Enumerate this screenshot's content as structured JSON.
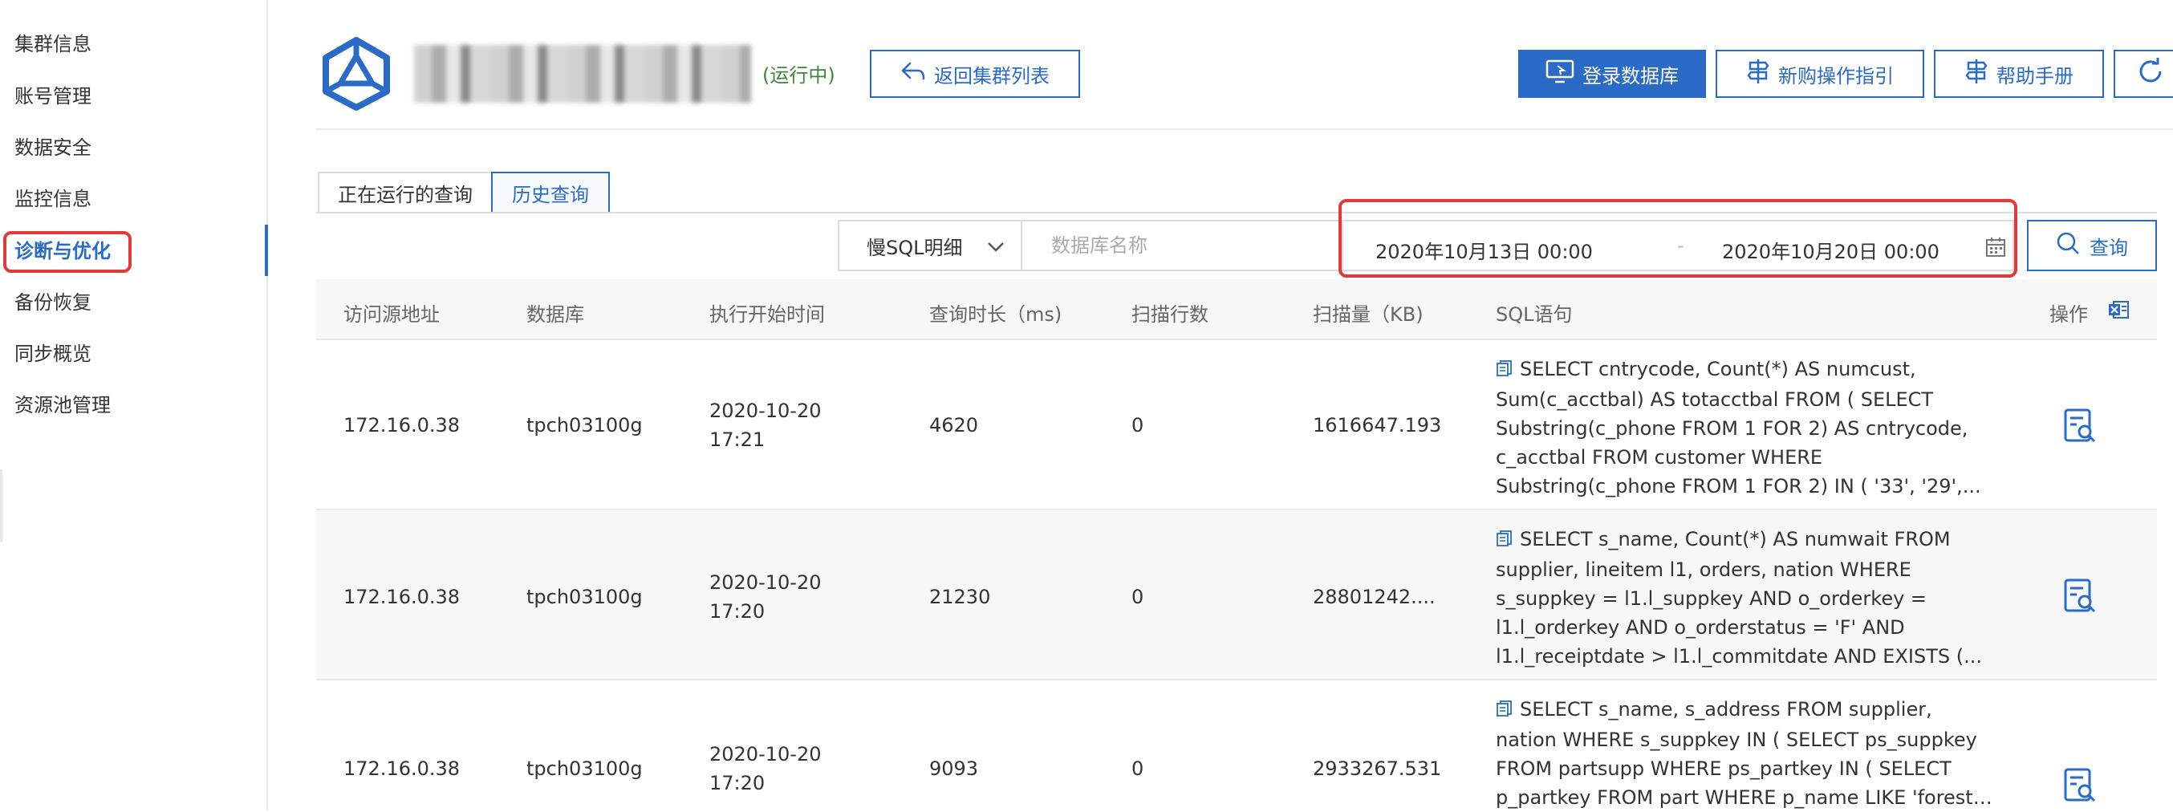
{
  "sidebar": {
    "items": [
      {
        "label": "集群信息"
      },
      {
        "label": "账号管理"
      },
      {
        "label": "数据安全"
      },
      {
        "label": "监控信息"
      },
      {
        "label": "诊断与优化",
        "active": true
      },
      {
        "label": "备份恢复"
      },
      {
        "label": "同步概览"
      },
      {
        "label": "资源池管理"
      }
    ]
  },
  "header": {
    "status": "(运行中)",
    "back_button": "返回集群列表",
    "login_db_button": "登录数据库",
    "purchase_guide_button": "新购操作指引",
    "help_button": "帮助手册"
  },
  "tabs": [
    {
      "label": "正在运行的查询"
    },
    {
      "label": "历史查询",
      "active": true
    }
  ],
  "filters": {
    "type_select": "慢SQL明细",
    "db_placeholder": "数据库名称",
    "date_start": "2020年10月13日 00:00",
    "date_sep": "-",
    "date_end": "2020年10月20日 00:00",
    "query_button": "查询"
  },
  "table": {
    "headers": [
      "访问源地址",
      "数据库",
      "执行开始时间",
      "查询时长（ms)",
      "扫描行数",
      "扫描量（KB)",
      "SQL语句",
      "操作"
    ],
    "rows": [
      {
        "source": "172.16.0.38",
        "database": "tpch03100g",
        "start_date": "2020-10-20",
        "start_time": "17:21",
        "duration": "4620",
        "scan_rows": "0",
        "scan_kb": "1616647.193",
        "sql_lines": [
          "SELECT cntrycode, Count(*) AS numcust,",
          "Sum(c_acctbal) AS totacctbal FROM ( SELECT",
          "Substring(c_phone FROM 1 FOR 2) AS cntrycode,",
          "c_acctbal FROM customer WHERE",
          "Substring(c_phone FROM 1 FOR 2) IN ( '33', '29',..."
        ]
      },
      {
        "source": "172.16.0.38",
        "database": "tpch03100g",
        "start_date": "2020-10-20",
        "start_time": "17:20",
        "duration": "21230",
        "scan_rows": "0",
        "scan_kb": "28801242....",
        "sql_lines": [
          "SELECT s_name, Count(*) AS numwait FROM",
          "supplier, lineitem l1, orders, nation WHERE",
          "s_suppkey = l1.l_suppkey AND o_orderkey =",
          "l1.l_orderkey AND o_orderstatus = 'F' AND",
          "l1.l_receiptdate > l1.l_commitdate AND EXISTS (..."
        ]
      },
      {
        "source": "172.16.0.38",
        "database": "tpch03100g",
        "start_date": "2020-10-20",
        "start_time": "17:20",
        "duration": "9093",
        "scan_rows": "0",
        "scan_kb": "2933267.531",
        "sql_lines": [
          "SELECT s_name, s_address FROM supplier,",
          "nation WHERE s_suppkey IN ( SELECT ps_suppkey",
          "FROM partsupp WHERE ps_partkey IN ( SELECT",
          "p_partkey FROM part WHERE p_name LIKE 'forest%'"
        ]
      }
    ]
  },
  "colors": {
    "accent": "#2a6bc7",
    "highlight": "#e03a3a",
    "status_green": "#3a8a3a"
  }
}
